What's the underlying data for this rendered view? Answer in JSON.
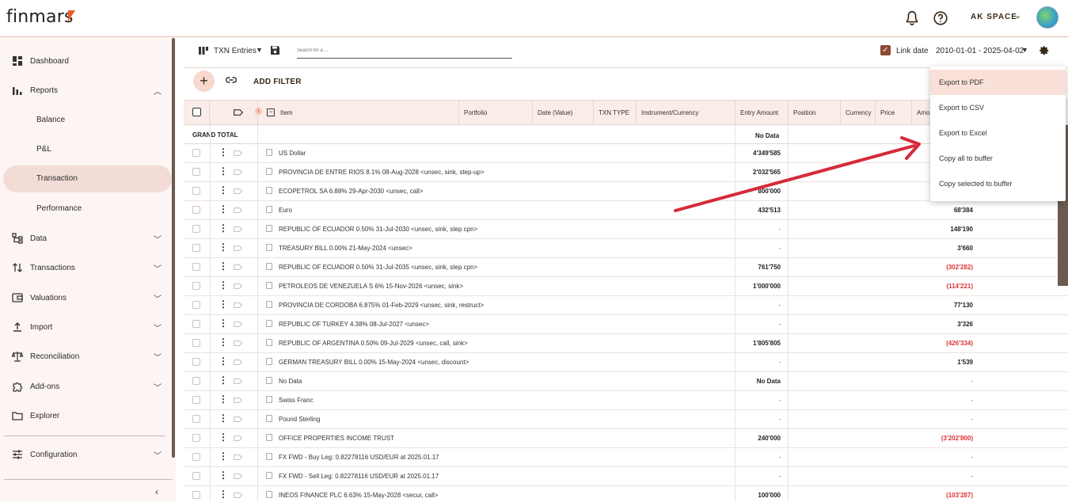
{
  "app": {
    "logo_text": "finmars"
  },
  "topbar": {
    "space_label": "AK SPACE",
    "space_caret": "⌄"
  },
  "sidebar": {
    "items": [
      {
        "label": "Dashboard"
      },
      {
        "label": "Reports"
      },
      {
        "label": "Balance"
      },
      {
        "label": "P&L"
      },
      {
        "label": "Transaction"
      },
      {
        "label": "Performance"
      },
      {
        "label": "Data"
      },
      {
        "label": "Transactions"
      },
      {
        "label": "Valuations"
      },
      {
        "label": "Import"
      },
      {
        "label": "Reconciliation"
      },
      {
        "label": "Add-ons"
      },
      {
        "label": "Explorer"
      },
      {
        "label": "Configuration"
      }
    ],
    "collapse_glyph": "‹"
  },
  "toolbar": {
    "layout_name": "TXN Entries",
    "search_placeholder": "Search for a ...",
    "link_date_label": "Link date",
    "date_range": "2010-01-01 - 2025-04-02",
    "add_filter_label": "ADD FILTER"
  },
  "table": {
    "columns": [
      "Item",
      "Portfolio",
      "Date (Value)",
      "TXN TYPE",
      "Instrument/Currency",
      "Entry Amount",
      "Position",
      "Currency",
      "Price",
      "Amo"
    ],
    "grand_total_label": "GRAND TOTAL",
    "grand_total_entry": "No Data",
    "rows": [
      {
        "item": "US Dollar",
        "entry": "4'349'585",
        "amount": ""
      },
      {
        "item": "PROVINCIA DE ENTRE RIOS  8.1%  08-Aug-2028  <unsec, sink, step-up>",
        "entry": "2'032'565",
        "amount": ""
      },
      {
        "item": "ECOPETROL SA  6.88%  29-Apr-2030  <unsec, call>",
        "entry": "800'000",
        "amount": ""
      },
      {
        "item": "Euro",
        "entry": "432'513",
        "amount": "68'384"
      },
      {
        "item": "REPUBLIC OF ECUADOR  0.50%  31-Jul-2030  <unsec, sink, step cpn>",
        "entry": "-",
        "amount": "148'190"
      },
      {
        "item": "TREASURY BILL  0.00%  21-May-2024  <unsec>",
        "entry": "-",
        "amount": "3'660"
      },
      {
        "item": "REPUBLIC OF ECUADOR  0.50%  31-Jul-2035  <unsec, sink, step cpn>",
        "entry": "761'750",
        "amount": "(302'282)"
      },
      {
        "item": "PETROLEOS DE VENEZUELA S  6%  15-Nov-2026  <unsec, sink>",
        "entry": "1'000'000",
        "amount": "(114'221)"
      },
      {
        "item": "PROVINCIA DE CORDOBA  6.875%  01-Feb-2029  <unsec, sink, restruct>",
        "entry": "-",
        "amount": "77'130"
      },
      {
        "item": "REPUBLIC OF TURKEY  4.38%  08-Jul-2027  <unsec>",
        "entry": "-",
        "amount": "3'326"
      },
      {
        "item": "REPUBLIC OF ARGENTINA  0.50%  09-Jul-2029  <unsec, call, sink>",
        "entry": "1'805'805",
        "amount": "(426'334)"
      },
      {
        "item": "GERMAN TREASURY BILL  0.00%  15-May-2024  <unsec, discount>",
        "entry": "-",
        "amount": "1'539"
      },
      {
        "item": "No Data",
        "entry": "No Data",
        "amount": "-"
      },
      {
        "item": "Swiss Franc",
        "entry": "-",
        "amount": "-"
      },
      {
        "item": "Pound Sterling",
        "entry": "-",
        "amount": "-"
      },
      {
        "item": "OFFICE PROPERTIES INCOME TRUST",
        "entry": "240'000",
        "amount": "(3'202'800)"
      },
      {
        "item": "FX FWD - Buy Leg: 0.82278116 USD/EUR at 2025.01.17",
        "entry": "-",
        "amount": "-"
      },
      {
        "item": "FX FWD - Sell Leg: 0.82278116 USD/EUR at 2025.01.17",
        "entry": "-",
        "amount": "-"
      },
      {
        "item": "INEOS FINANCE PLC  6.63%  15-May-2028  <secur, call>",
        "entry": "100'000",
        "amount": "(103'287)"
      }
    ]
  },
  "export_menu": {
    "items": [
      "Export to PDF",
      "Export to CSV",
      "Export to Excel",
      "Copy all to buffer",
      "Copy selected to buffer"
    ]
  },
  "colors": {
    "accent": "#f05a28",
    "active_nav": "#f3dcd6",
    "negative": "#d33333",
    "annotation_arrow": "#d62a3a"
  }
}
